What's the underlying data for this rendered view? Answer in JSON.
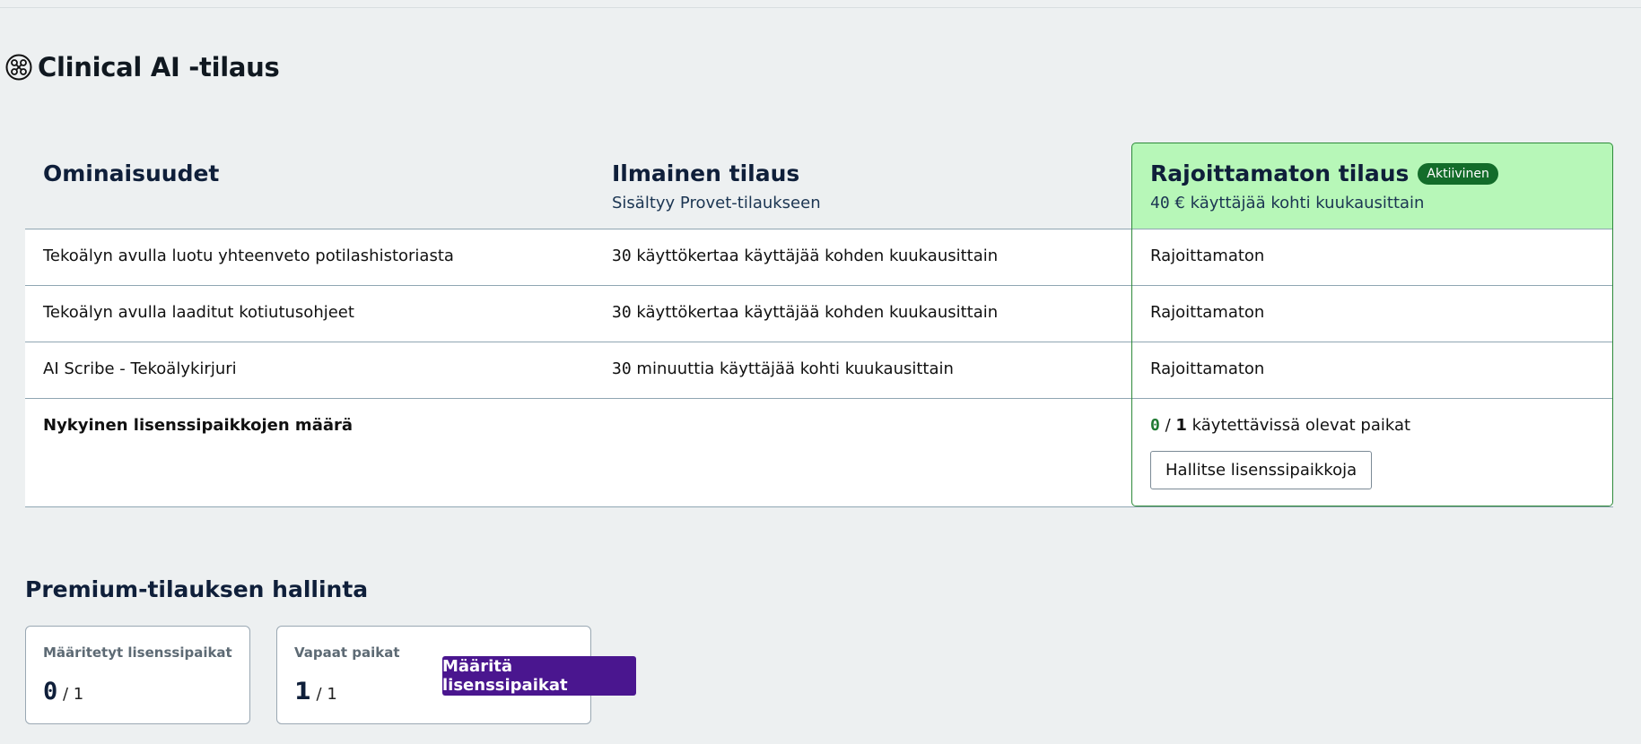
{
  "page": {
    "title": "Clinical AI -tilaus",
    "icon": "clinical-ai-icon"
  },
  "table": {
    "headers": {
      "features": "Ominaisuudet",
      "free_title": "Ilmainen tilaus",
      "free_subtitle": "Sisältyy Provet-tilaukseen",
      "unlimited_title": "Rajoittamaton tilaus",
      "unlimited_badge": "Aktiivinen",
      "unlimited_price_num": "40",
      "unlimited_price_rest": "€ käyttäjää kohti kuukausittain"
    },
    "rows": [
      {
        "feature": "Tekoälyn avulla luotu yhteenveto potilashistoriasta",
        "free_num": "30",
        "free_text": "käyttökertaa käyttäjää kohden kuukausittain",
        "unlimited": "Rajoittamaton"
      },
      {
        "feature": "Tekoälyn avulla laaditut kotiutusohjeet",
        "free_num": "30",
        "free_text": "käyttökertaa käyttäjää kohden kuukausittain",
        "unlimited": "Rajoittamaton"
      },
      {
        "feature": "AI Scribe - Tekoälykirjuri",
        "free_num": "30",
        "free_text": "minuuttia käyttäjää kohti kuukausittain",
        "unlimited": "Rajoittamaton"
      }
    ],
    "seats": {
      "label": "Nykyinen lisenssipaikkojen määrä",
      "used": "0",
      "separator": "/",
      "total": "1",
      "suffix": "käytettävissä olevat paikat",
      "manage_button": "Hallitse lisenssipaikkoja"
    }
  },
  "premium": {
    "title": "Premium-tilauksen hallinta",
    "assigned": {
      "label": "Määritetyt lisenssipaikat",
      "value": "0",
      "total": "/ 1"
    },
    "free": {
      "label": "Vapaat paikat",
      "value": "1",
      "total": "/ 1"
    },
    "assign_button": "Määritä lisenssipaikat"
  },
  "colors": {
    "accent": "#4a168f",
    "active_green": "#136c2a",
    "active_bg": "#b7f7b8"
  }
}
